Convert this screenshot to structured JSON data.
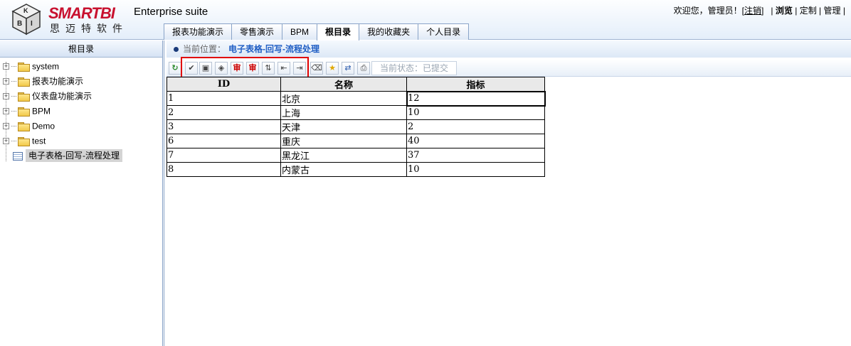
{
  "header": {
    "brand": "SMARTBI",
    "brand_cn": "思迈特软件",
    "suite": "Enterprise suite",
    "welcome": "欢迎您，管理员！[",
    "logout": "注销",
    "welcome_close": "]",
    "sep1": "|",
    "browse": "浏览",
    "sep2": "|",
    "customize": "定制",
    "sep3": "|",
    "manage": "管理",
    "sep4": "|"
  },
  "tabs": [
    {
      "label": "报表功能演示",
      "active": false
    },
    {
      "label": "零售演示",
      "active": false
    },
    {
      "label": "BPM",
      "active": false
    },
    {
      "label": "根目录",
      "active": true
    },
    {
      "label": "我的收藏夹",
      "active": false
    },
    {
      "label": "个人目录",
      "active": false
    }
  ],
  "left": {
    "title": "根目录",
    "tree": [
      {
        "label": "system",
        "type": "folder"
      },
      {
        "label": "报表功能演示",
        "type": "folder"
      },
      {
        "label": "仪表盘功能演示",
        "type": "folder"
      },
      {
        "label": "BPM",
        "type": "folder"
      },
      {
        "label": "Demo",
        "type": "folder"
      },
      {
        "label": "test",
        "type": "folder"
      },
      {
        "label": "电子表格-回写-流程处理",
        "type": "sheet",
        "selected": true
      }
    ]
  },
  "breadcrumb": {
    "prefix": "当前位置：",
    "current": "电子表格-回写-流程处理"
  },
  "toolbar": {
    "buttons": [
      {
        "name": "refresh-icon",
        "glyph": "↻"
      },
      {
        "name": "submit-icon",
        "glyph": "✔"
      },
      {
        "name": "save-icon",
        "glyph": "▣"
      },
      {
        "name": "package-icon",
        "glyph": "◈"
      },
      {
        "name": "approve-icon",
        "glyph": "审"
      },
      {
        "name": "approve-multi-icon",
        "glyph": "审"
      },
      {
        "name": "insert-row-icon",
        "glyph": "⇅"
      },
      {
        "name": "delete-row-icon",
        "glyph": "⇤"
      },
      {
        "name": "move-icon",
        "glyph": "⇥"
      },
      {
        "name": "eraser-icon",
        "glyph": "⌫"
      },
      {
        "name": "favorite-icon",
        "glyph": "★"
      },
      {
        "name": "export-icon",
        "glyph": "⇄"
      },
      {
        "name": "print-icon",
        "glyph": "⎙"
      }
    ],
    "status": "当前状态：已提交"
  },
  "grid": {
    "headers": [
      "ID",
      "名称",
      "指标"
    ],
    "rows": [
      [
        "1",
        "北京",
        "12"
      ],
      [
        "2",
        "上海",
        "10"
      ],
      [
        "3",
        "天津",
        "2"
      ],
      [
        "6",
        "重庆",
        "40"
      ],
      [
        "7",
        "黑龙江",
        "37"
      ],
      [
        "8",
        "内蒙古",
        "10"
      ]
    ]
  },
  "colors": {
    "brand_red": "#c8102e",
    "link_blue": "#1f5ec4",
    "highlight_red": "#e00000"
  }
}
